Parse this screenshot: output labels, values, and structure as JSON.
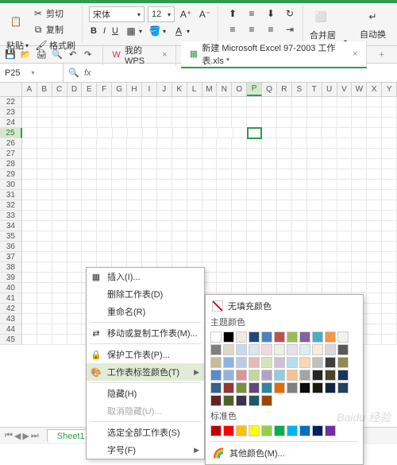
{
  "ribbon": {
    "paste": "粘贴",
    "cut": "剪切",
    "copy": "复制",
    "format_painter": "格式刷",
    "font_name": "宋体",
    "font_size": "12",
    "merge_center": "合并居中",
    "auto_wrap": "自动换"
  },
  "tabs": {
    "mywps": "我的WPS",
    "doc": "新建 Microsoft Excel 97-2003 工作表.xls *"
  },
  "namebox": "P25",
  "fx": "fx",
  "cols": [
    "A",
    "B",
    "C",
    "D",
    "E",
    "F",
    "G",
    "H",
    "I",
    "J",
    "K",
    "L",
    "M",
    "N",
    "O",
    "P",
    "Q",
    "R",
    "S",
    "T",
    "U",
    "V",
    "W",
    "X",
    "Y"
  ],
  "rows": [
    "22",
    "23",
    "24",
    "25",
    "26",
    "27",
    "28",
    "29",
    "30",
    "31",
    "32",
    "33",
    "34",
    "35",
    "36",
    "37",
    "38",
    "39",
    "40",
    "41",
    "42",
    "43",
    "44",
    "45"
  ],
  "selected_col": "P",
  "selected_row": "25",
  "ctx": {
    "insert": "插入(I)...",
    "delete_sheet": "删除工作表(D)",
    "rename": "重命名(R)",
    "move_copy": "移动或复制工作表(M)...",
    "protect": "保护工作表(P)...",
    "tab_color": "工作表标签颜色(T)",
    "hide_h": "隐藏(H)",
    "unhide": "取消隐藏(U)...",
    "select_all": "选定全部工作表(S)",
    "font_f": "字号(F)"
  },
  "color_menu": {
    "no_fill": "无填充颜色",
    "theme": "主题颜色",
    "standard": "标准色",
    "other": "其他颜色(M)..."
  },
  "theme_colors": [
    "#ffffff",
    "#000000",
    "#eeece1",
    "#1f497d",
    "#4f81bd",
    "#c0504d",
    "#9bbb59",
    "#8064a2",
    "#4bacc6",
    "#f79646",
    "#f2f2f2",
    "#7f7f7f",
    "#ddd9c3",
    "#c6d9f0",
    "#dbe5f1",
    "#f2dcdb",
    "#ebf1dd",
    "#e5e0ec",
    "#dbeef3",
    "#fdeada",
    "#d8d8d8",
    "#595959",
    "#c4bd97",
    "#8db3e2",
    "#b8cce4",
    "#e5b9b7",
    "#d7e3bc",
    "#ccc1d9",
    "#b7dde8",
    "#fbd5b5",
    "#bfbfbf",
    "#3f3f3f",
    "#938953",
    "#548dd4",
    "#95b3d7",
    "#d99694",
    "#c3d69b",
    "#b2a2c7",
    "#92cddc",
    "#fac08f",
    "#a5a5a5",
    "#262626",
    "#494429",
    "#17365d",
    "#366092",
    "#953734",
    "#76923c",
    "#5f497a",
    "#31859b",
    "#e36c09",
    "#7f7f7f",
    "#0c0c0c",
    "#1d1b10",
    "#0f243e",
    "#244061",
    "#632423",
    "#4f6128",
    "#3f3151",
    "#205867",
    "#974806"
  ],
  "standard_colors": [
    "#c00000",
    "#ff0000",
    "#ffc000",
    "#ffff00",
    "#92d050",
    "#00b050",
    "#00b0f0",
    "#0070c0",
    "#002060",
    "#7030a0"
  ],
  "sheet": {
    "name": "Sheet1"
  },
  "watermark": "Baidu 经验"
}
